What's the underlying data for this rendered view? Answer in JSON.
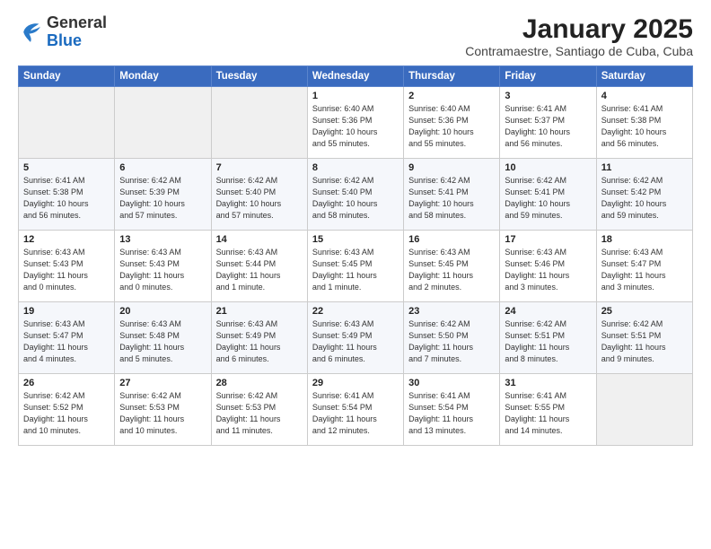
{
  "logo": {
    "general": "General",
    "blue": "Blue"
  },
  "title": "January 2025",
  "subtitle": "Contramaestre, Santiago de Cuba, Cuba",
  "days_header": [
    "Sunday",
    "Monday",
    "Tuesday",
    "Wednesday",
    "Thursday",
    "Friday",
    "Saturday"
  ],
  "weeks": [
    [
      {
        "day": "",
        "info": ""
      },
      {
        "day": "",
        "info": ""
      },
      {
        "day": "",
        "info": ""
      },
      {
        "day": "1",
        "info": "Sunrise: 6:40 AM\nSunset: 5:36 PM\nDaylight: 10 hours\nand 55 minutes."
      },
      {
        "day": "2",
        "info": "Sunrise: 6:40 AM\nSunset: 5:36 PM\nDaylight: 10 hours\nand 55 minutes."
      },
      {
        "day": "3",
        "info": "Sunrise: 6:41 AM\nSunset: 5:37 PM\nDaylight: 10 hours\nand 56 minutes."
      },
      {
        "day": "4",
        "info": "Sunrise: 6:41 AM\nSunset: 5:38 PM\nDaylight: 10 hours\nand 56 minutes."
      }
    ],
    [
      {
        "day": "5",
        "info": "Sunrise: 6:41 AM\nSunset: 5:38 PM\nDaylight: 10 hours\nand 56 minutes."
      },
      {
        "day": "6",
        "info": "Sunrise: 6:42 AM\nSunset: 5:39 PM\nDaylight: 10 hours\nand 57 minutes."
      },
      {
        "day": "7",
        "info": "Sunrise: 6:42 AM\nSunset: 5:40 PM\nDaylight: 10 hours\nand 57 minutes."
      },
      {
        "day": "8",
        "info": "Sunrise: 6:42 AM\nSunset: 5:40 PM\nDaylight: 10 hours\nand 58 minutes."
      },
      {
        "day": "9",
        "info": "Sunrise: 6:42 AM\nSunset: 5:41 PM\nDaylight: 10 hours\nand 58 minutes."
      },
      {
        "day": "10",
        "info": "Sunrise: 6:42 AM\nSunset: 5:41 PM\nDaylight: 10 hours\nand 59 minutes."
      },
      {
        "day": "11",
        "info": "Sunrise: 6:42 AM\nSunset: 5:42 PM\nDaylight: 10 hours\nand 59 minutes."
      }
    ],
    [
      {
        "day": "12",
        "info": "Sunrise: 6:43 AM\nSunset: 5:43 PM\nDaylight: 11 hours\nand 0 minutes."
      },
      {
        "day": "13",
        "info": "Sunrise: 6:43 AM\nSunset: 5:43 PM\nDaylight: 11 hours\nand 0 minutes."
      },
      {
        "day": "14",
        "info": "Sunrise: 6:43 AM\nSunset: 5:44 PM\nDaylight: 11 hours\nand 1 minute."
      },
      {
        "day": "15",
        "info": "Sunrise: 6:43 AM\nSunset: 5:45 PM\nDaylight: 11 hours\nand 1 minute."
      },
      {
        "day": "16",
        "info": "Sunrise: 6:43 AM\nSunset: 5:45 PM\nDaylight: 11 hours\nand 2 minutes."
      },
      {
        "day": "17",
        "info": "Sunrise: 6:43 AM\nSunset: 5:46 PM\nDaylight: 11 hours\nand 3 minutes."
      },
      {
        "day": "18",
        "info": "Sunrise: 6:43 AM\nSunset: 5:47 PM\nDaylight: 11 hours\nand 3 minutes."
      }
    ],
    [
      {
        "day": "19",
        "info": "Sunrise: 6:43 AM\nSunset: 5:47 PM\nDaylight: 11 hours\nand 4 minutes."
      },
      {
        "day": "20",
        "info": "Sunrise: 6:43 AM\nSunset: 5:48 PM\nDaylight: 11 hours\nand 5 minutes."
      },
      {
        "day": "21",
        "info": "Sunrise: 6:43 AM\nSunset: 5:49 PM\nDaylight: 11 hours\nand 6 minutes."
      },
      {
        "day": "22",
        "info": "Sunrise: 6:43 AM\nSunset: 5:49 PM\nDaylight: 11 hours\nand 6 minutes."
      },
      {
        "day": "23",
        "info": "Sunrise: 6:42 AM\nSunset: 5:50 PM\nDaylight: 11 hours\nand 7 minutes."
      },
      {
        "day": "24",
        "info": "Sunrise: 6:42 AM\nSunset: 5:51 PM\nDaylight: 11 hours\nand 8 minutes."
      },
      {
        "day": "25",
        "info": "Sunrise: 6:42 AM\nSunset: 5:51 PM\nDaylight: 11 hours\nand 9 minutes."
      }
    ],
    [
      {
        "day": "26",
        "info": "Sunrise: 6:42 AM\nSunset: 5:52 PM\nDaylight: 11 hours\nand 10 minutes."
      },
      {
        "day": "27",
        "info": "Sunrise: 6:42 AM\nSunset: 5:53 PM\nDaylight: 11 hours\nand 10 minutes."
      },
      {
        "day": "28",
        "info": "Sunrise: 6:42 AM\nSunset: 5:53 PM\nDaylight: 11 hours\nand 11 minutes."
      },
      {
        "day": "29",
        "info": "Sunrise: 6:41 AM\nSunset: 5:54 PM\nDaylight: 11 hours\nand 12 minutes."
      },
      {
        "day": "30",
        "info": "Sunrise: 6:41 AM\nSunset: 5:54 PM\nDaylight: 11 hours\nand 13 minutes."
      },
      {
        "day": "31",
        "info": "Sunrise: 6:41 AM\nSunset: 5:55 PM\nDaylight: 11 hours\nand 14 minutes."
      },
      {
        "day": "",
        "info": ""
      }
    ]
  ]
}
